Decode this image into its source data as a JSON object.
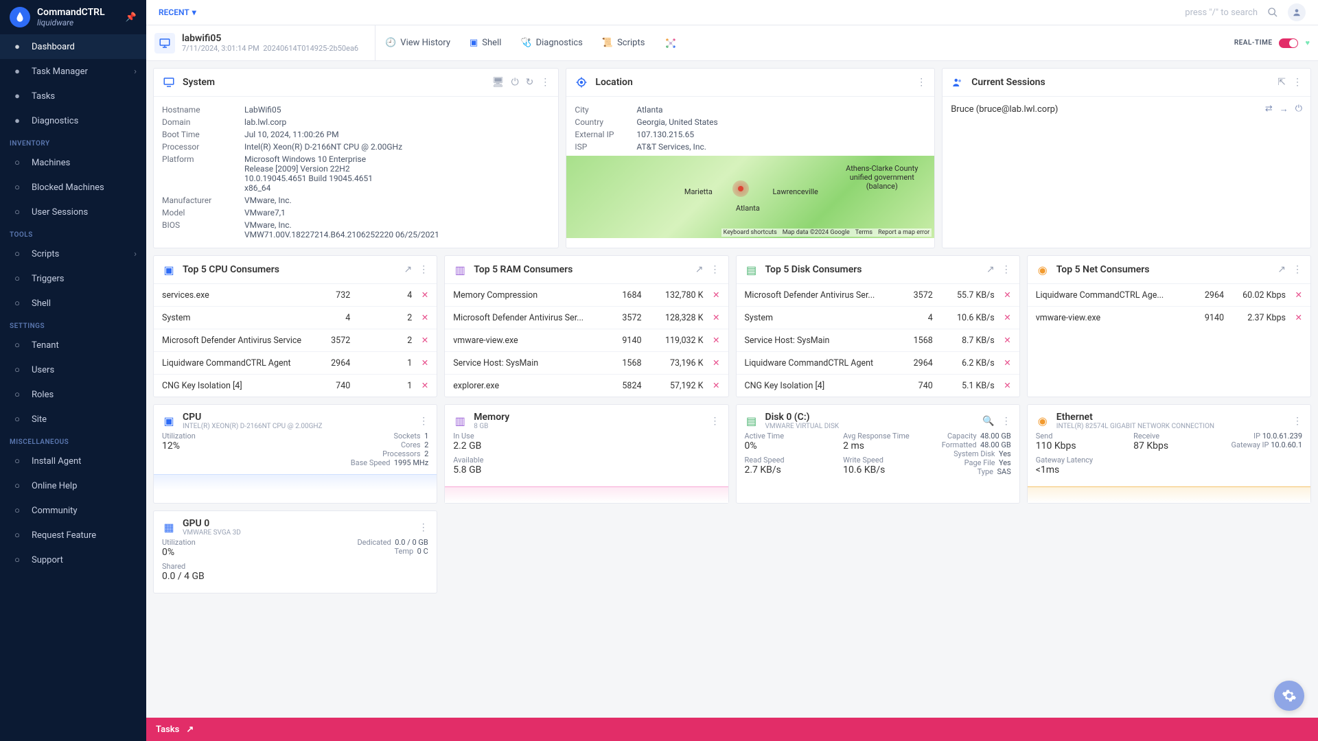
{
  "brand": {
    "title": "CommandCTRL",
    "subtitle": "liquidware"
  },
  "sidebar": {
    "main": [
      {
        "label": "Dashboard",
        "active": true
      },
      {
        "label": "Task Manager",
        "caret": true
      },
      {
        "label": "Tasks"
      },
      {
        "label": "Diagnostics"
      }
    ],
    "sections": [
      {
        "title": "Inventory",
        "items": [
          {
            "label": "Machines"
          },
          {
            "label": "Blocked Machines"
          },
          {
            "label": "User Sessions"
          }
        ]
      },
      {
        "title": "Tools",
        "items": [
          {
            "label": "Scripts",
            "caret": true
          },
          {
            "label": "Triggers"
          },
          {
            "label": "Shell"
          }
        ]
      },
      {
        "title": "Settings",
        "items": [
          {
            "label": "Tenant"
          },
          {
            "label": "Users"
          },
          {
            "label": "Roles"
          },
          {
            "label": "Site"
          }
        ]
      },
      {
        "title": "Miscellaneous",
        "items": [
          {
            "label": "Install Agent"
          },
          {
            "label": "Online Help"
          },
          {
            "label": "Community"
          },
          {
            "label": "Request Feature"
          },
          {
            "label": "Support"
          }
        ]
      }
    ]
  },
  "topbar": {
    "recent": "RECENT",
    "search_hint": "press \"/\" to search"
  },
  "machine": {
    "name": "labwifi05",
    "sub1": "7/11/2024, 3:01:14 PM",
    "sub2": "20240614T014925-2b50ea6",
    "tabs": [
      "View History",
      "Shell",
      "Diagnostics",
      "Scripts"
    ],
    "realtime": "Real-time"
  },
  "system": {
    "title": "System",
    "rows": [
      [
        "Hostname",
        "LabWifi05"
      ],
      [
        "Domain",
        "lab.lwl.corp"
      ],
      [
        "Boot Time",
        "Jul 10, 2024, 11:00:26 PM"
      ],
      [
        "Processor",
        "Intel(R) Xeon(R) D-2166NT CPU @ 2.00GHz"
      ],
      [
        "Platform",
        "Microsoft Windows 10 Enterprise\nRelease [2009] Version 22H2\n10.0.19045.4651 Build 19045.4651\nx86_64"
      ],
      [
        "Manufacturer",
        "VMware, Inc."
      ],
      [
        "Model",
        "VMware7,1"
      ],
      [
        "BIOS",
        "VMware, Inc.\nVMW71.00V.18227214.B64.2106252220 06/25/2021"
      ]
    ]
  },
  "location": {
    "title": "Location",
    "rows": [
      [
        "City",
        "Atlanta"
      ],
      [
        "Country",
        "Georgia, United States"
      ],
      [
        "External IP",
        "107.130.215.65"
      ],
      [
        "ISP",
        "AT&T Services, Inc."
      ]
    ],
    "labels": {
      "a": "Atlanta",
      "b": "Marietta",
      "c": "Lawrenceville",
      "d": "Athens-Clarke County unified government (balance)"
    },
    "foot": [
      "Keyboard shortcuts",
      "Map data ©2024 Google",
      "Terms",
      "Report a map error"
    ]
  },
  "sessions": {
    "title": "Current Sessions",
    "user": "Bruce (bruce@lab.lwl.corp)"
  },
  "cpu_top": {
    "title": "Top 5 CPU Consumers",
    "rows": [
      [
        "services.exe",
        "732",
        "4"
      ],
      [
        "System",
        "4",
        "2"
      ],
      [
        "Microsoft Defender Antivirus Service",
        "3572",
        "2"
      ],
      [
        "Liquidware CommandCTRL Agent",
        "2964",
        "1"
      ],
      [
        "CNG Key Isolation [4]",
        "740",
        "1"
      ]
    ]
  },
  "ram_top": {
    "title": "Top 5 RAM Consumers",
    "rows": [
      [
        "Memory Compression",
        "1684",
        "132,780 K"
      ],
      [
        "Microsoft Defender Antivirus Ser...",
        "3572",
        "128,328 K"
      ],
      [
        "vmware-view.exe",
        "9140",
        "119,032 K"
      ],
      [
        "Service Host: SysMain",
        "1568",
        "73,196 K"
      ],
      [
        "explorer.exe",
        "5824",
        "57,192 K"
      ]
    ]
  },
  "disk_top": {
    "title": "Top 5 Disk Consumers",
    "rows": [
      [
        "Microsoft Defender Antivirus Ser...",
        "3572",
        "55.7 KB/s"
      ],
      [
        "System",
        "4",
        "10.6 KB/s"
      ],
      [
        "Service Host: SysMain",
        "1568",
        "8.7 KB/s"
      ],
      [
        "Liquidware CommandCTRL Agent",
        "2964",
        "6.2 KB/s"
      ],
      [
        "CNG Key Isolation [4]",
        "740",
        "5.1 KB/s"
      ]
    ]
  },
  "net_top": {
    "title": "Top 5 Net Consumers",
    "rows": [
      [
        "Liquidware CommandCTRL Age...",
        "2964",
        "60.02 Kbps"
      ],
      [
        "vmware-view.exe",
        "9140",
        "2.37 Kbps"
      ]
    ]
  },
  "cpu_card": {
    "title": "CPU",
    "sub": "INTEL(R) XEON(R) D-2166NT CPU @ 2.00GHZ",
    "util_l": "Utilization",
    "util_v": "12%",
    "right": [
      [
        "Sockets",
        "1"
      ],
      [
        "Cores",
        "2"
      ],
      [
        "Processors",
        "2"
      ],
      [
        "Base Speed",
        "1995 MHz"
      ]
    ]
  },
  "mem_card": {
    "title": "Memory",
    "sub": "8 GB",
    "inuse_l": "In Use",
    "inuse_v": "2.2 GB",
    "avail_l": "Available",
    "avail_v": "5.8 GB"
  },
  "disk_card": {
    "title": "Disk 0 (C:)",
    "sub": "VMWARE VIRTUAL DISK",
    "left": [
      [
        "Active Time",
        "0%"
      ],
      [
        "Read Speed",
        "2.7 KB/s"
      ]
    ],
    "mid": [
      [
        "Avg Response Time",
        "2 ms"
      ],
      [
        "Write Speed",
        "10.6 KB/s"
      ]
    ],
    "right": [
      [
        "Capacity",
        "48.00 GB"
      ],
      [
        "Formatted",
        "48.00 GB"
      ],
      [
        "System Disk",
        "Yes"
      ],
      [
        "Page File",
        "Yes"
      ],
      [
        "Type",
        "SAS"
      ]
    ]
  },
  "eth_card": {
    "title": "Ethernet",
    "sub": "INTEL(R) 82574L GIGABIT NETWORK CONNECTION",
    "send_l": "Send",
    "send_v": "110 Kbps",
    "recv_l": "Receive",
    "recv_v": "87 Kbps",
    "gl_l": "Gateway Latency",
    "gl_v": "<1ms",
    "ip_l": "IP",
    "ip_v": "10.0.61.239",
    "gw_l": "Gateway IP",
    "gw_v": "10.0.60.1"
  },
  "gpu_card": {
    "title": "GPU 0",
    "sub": "VMWARE SVGA 3D",
    "util_l": "Utilization",
    "util_v": "0%",
    "shared_l": "Shared",
    "shared_v": "0.0 / 4 GB",
    "right": [
      [
        "Dedicated",
        "0.0 / 0 GB"
      ],
      [
        "Temp",
        "0 C"
      ]
    ]
  },
  "tasksbar": {
    "label": "Tasks"
  },
  "colors": {
    "ic_blue": "#2e6cf6",
    "ic_pink": "#e74c8a",
    "ic_green": "#45b26b",
    "ic_orange": "#f29a2e",
    "ic_purple": "#9d63d8"
  }
}
